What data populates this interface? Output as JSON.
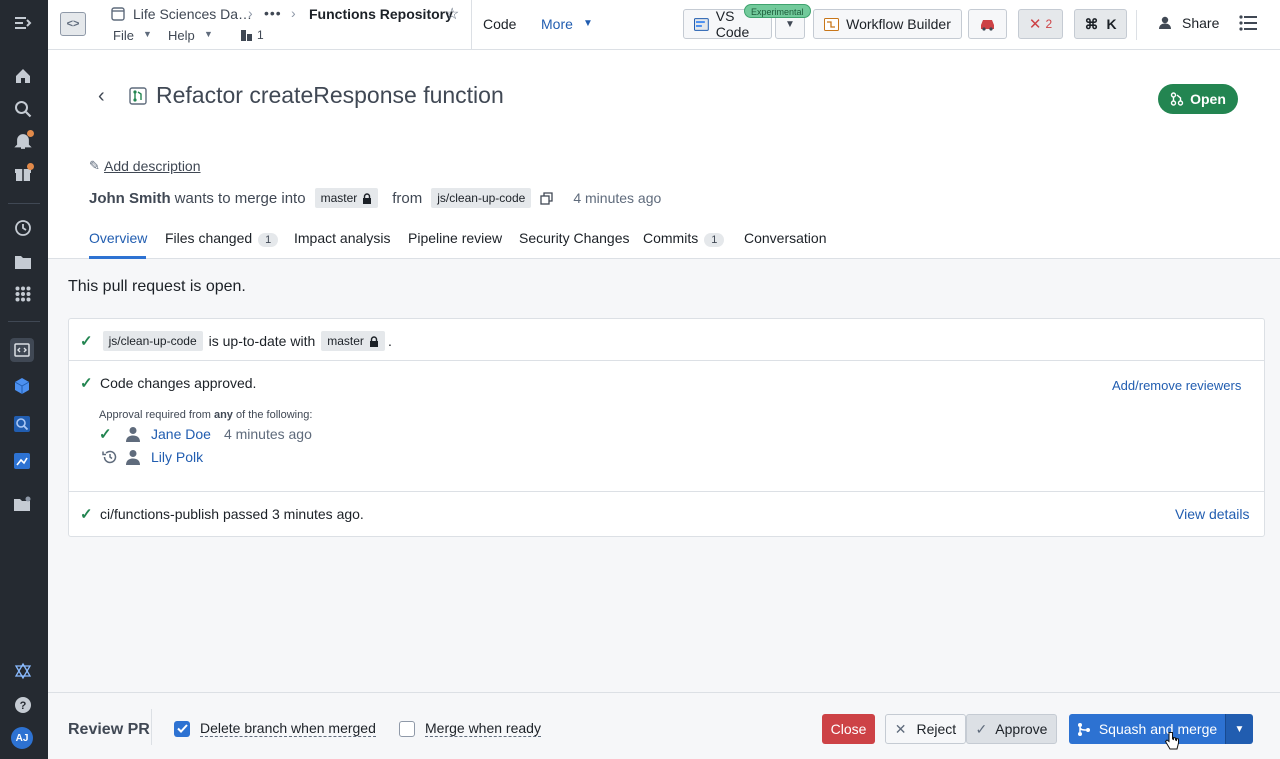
{
  "header": {
    "breadcrumb_project": "Life Sciences Da…",
    "breadcrumb_more": "•••",
    "breadcrumb_repo": "Functions Repository",
    "menu_file": "File",
    "menu_help": "Help",
    "branch_count": "1",
    "tab_code": "Code",
    "tab_more": "More",
    "experimental_badge": "Experimental",
    "vscode_label": "VS Code",
    "workflow_builder_label": "Workflow Builder",
    "error_count": "2",
    "shortcut_label": "K",
    "share_label": "Share"
  },
  "pr": {
    "title": "Refactor createResponse function",
    "status": "Open",
    "add_description": "Add description",
    "author": "John Smith",
    "merge_text": "wants to merge into",
    "target_branch": "master",
    "from_text": "from",
    "source_branch": "js/clean-up-code",
    "time_ago": "4 minutes ago"
  },
  "tabs": [
    {
      "label": "Overview",
      "count": ""
    },
    {
      "label": "Files changed",
      "count": "1"
    },
    {
      "label": "Impact analysis",
      "count": ""
    },
    {
      "label": "Pipeline review",
      "count": ""
    },
    {
      "label": "Security Changes",
      "count": ""
    },
    {
      "label": "Commits",
      "count": "1"
    },
    {
      "label": "Conversation",
      "count": ""
    }
  ],
  "overview": {
    "status_heading": "This pull request is open.",
    "uptodate_branch": "js/clean-up-code",
    "uptodate_text": "is up-to-date with",
    "uptodate_target": "master",
    "uptodate_period": ".",
    "approved_text": "Code changes approved.",
    "add_reviewers": "Add/remove reviewers",
    "approval_prefix": "Approval required from",
    "approval_any": "any",
    "approval_suffix": "of the following:",
    "reviewers": [
      {
        "name": "Jane Doe",
        "time": "4 minutes ago",
        "state": "approved"
      },
      {
        "name": "Lily Polk",
        "time": "",
        "state": "pending"
      }
    ],
    "ci_text": "ci/functions-publish passed 3 minutes ago.",
    "view_details": "View details"
  },
  "footer": {
    "review_label": "Review PR",
    "delete_branch_label": "Delete branch when merged",
    "delete_branch_checked": true,
    "merge_ready_label": "Merge when ready",
    "merge_ready_checked": false,
    "close_label": "Close",
    "reject_label": "Reject",
    "approve_label": "Approve",
    "squash_label": "Squash and merge"
  },
  "colors": {
    "primary": "#2d72d2",
    "success": "#238551",
    "danger": "#cd4246",
    "rail": "#252a31"
  }
}
